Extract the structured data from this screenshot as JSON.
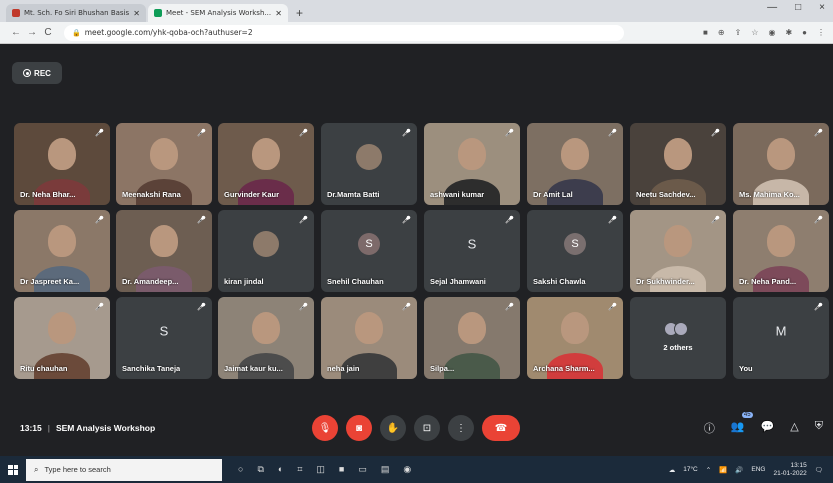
{
  "browser": {
    "tabs": [
      {
        "title": "Mt. Sch. Fo Siri Bhushan Basishtar Co.",
        "active": false
      },
      {
        "title": "Meet - SEM Analysis Worksh...",
        "active": true
      }
    ],
    "new_tab": "+",
    "url": "meet.google.com/yhk-qoba-och?authuser=2",
    "nav": {
      "back": "←",
      "forward": "→",
      "reload": "C"
    },
    "window_controls": [
      "—",
      "□",
      "×"
    ]
  },
  "meet": {
    "rec_label": "REC",
    "meeting_time": "13:15",
    "meeting_separator": "|",
    "meeting_name": "SEM Analysis Workshop",
    "participant_count_badge": "45",
    "tiles": [
      {
        "name": "Dr. Neha Bhar...",
        "type": "video",
        "bg": "#5d4a3c",
        "shirt": "#7a3b3b"
      },
      {
        "name": "Meenakshi Rana",
        "type": "video",
        "bg": "#8c7565",
        "shirt": "#5b4238"
      },
      {
        "name": "Gurvinder Kaur",
        "type": "video",
        "bg": "#6e5b4c",
        "shirt": "#6a2d4a"
      },
      {
        "name": "Dr.Mamta Batti",
        "type": "avatar_photo",
        "bg": "#3c4043",
        "shirt": "#555"
      },
      {
        "name": "ashwani kumar",
        "type": "video",
        "bg": "#9c8f7e",
        "shirt": "#2d2d2d"
      },
      {
        "name": "Dr Amit Lal",
        "type": "video",
        "bg": "#7d6f62",
        "shirt": "#3d3d4d"
      },
      {
        "name": "Neetu Sachdev...",
        "type": "video",
        "bg": "#4a423c",
        "shirt": "#6b5a4a"
      },
      {
        "name": "Ms. Mahima Ko...",
        "type": "video",
        "bg": "#7b6a5c",
        "shirt": "#c7b7a8"
      },
      {
        "name": "Dr Jaspreet Ka...",
        "type": "video",
        "bg": "#8b7868",
        "shirt": "#5c6a7b"
      },
      {
        "name": "Dr. Amandeep...",
        "type": "video",
        "bg": "#6d5e52",
        "shirt": "#7a5b6b"
      },
      {
        "name": "kiran jindal",
        "type": "avatar_photo",
        "bg": "#3c4043",
        "shirt": "#666"
      },
      {
        "name": "Snehil Chauhan",
        "type": "letter",
        "letter": "S",
        "letter_bg": "#7d6a6a"
      },
      {
        "name": "Sejal Jhamwani",
        "type": "letter_bare",
        "letter": "S"
      },
      {
        "name": "Sakshi Chawla",
        "type": "letter",
        "letter": "S",
        "letter_bg": "#7a6f6f"
      },
      {
        "name": "Dr Sukhwinder...",
        "type": "video",
        "bg": "#a39585",
        "shirt": "#c8b9a9"
      },
      {
        "name": "Dr. Neha Pand...",
        "type": "video",
        "bg": "#8e7e6f",
        "shirt": "#7d4a5a"
      },
      {
        "name": "Ritu chauhan",
        "type": "video",
        "bg": "#a69a8e",
        "shirt": "#6b4a3a"
      },
      {
        "name": "Sanchika Taneja",
        "type": "letter_bare",
        "letter": "S"
      },
      {
        "name": "Jaimat kaur ku...",
        "type": "video",
        "bg": "#8d8377",
        "shirt": "#4c4c4c"
      },
      {
        "name": "neha jain",
        "type": "video",
        "bg": "#9b8b7b",
        "shirt": "#3f3f3f"
      },
      {
        "name": "Silpa...",
        "type": "video",
        "bg": "#85796d",
        "shirt": "#4a5a4a"
      },
      {
        "name": "Archana Sharm...",
        "type": "video",
        "bg": "#a08a6f",
        "shirt": "#d13d3d"
      },
      {
        "name": "2 others",
        "type": "others"
      },
      {
        "name": "You",
        "type": "letter_bare",
        "letter": "M"
      }
    ],
    "controls": [
      {
        "name": "mic-off",
        "glyph": "🎙",
        "style": "red"
      },
      {
        "name": "camera-off",
        "glyph": "◙",
        "style": "red"
      },
      {
        "name": "raise-hand",
        "glyph": "✋",
        "style": "normal"
      },
      {
        "name": "present",
        "glyph": "⊡",
        "style": "normal"
      },
      {
        "name": "more-options",
        "glyph": "⋮",
        "style": "normal"
      },
      {
        "name": "leave-call",
        "glyph": "☎",
        "style": "end"
      }
    ],
    "right_controls": [
      {
        "name": "info",
        "glyph": "ⓘ"
      },
      {
        "name": "people",
        "glyph": "👥"
      },
      {
        "name": "chat",
        "glyph": "💬"
      },
      {
        "name": "activities",
        "glyph": "△"
      },
      {
        "name": "host-controls",
        "glyph": "⛨"
      }
    ]
  },
  "taskbar": {
    "search_placeholder": "Type here to search",
    "weather": "17°C",
    "lang": "ENG",
    "time": "13:15",
    "date": "21-01-2022"
  },
  "colors": {
    "meet_bg": "#202124",
    "tile_bg": "#3c4043",
    "red": "#ea4335"
  }
}
